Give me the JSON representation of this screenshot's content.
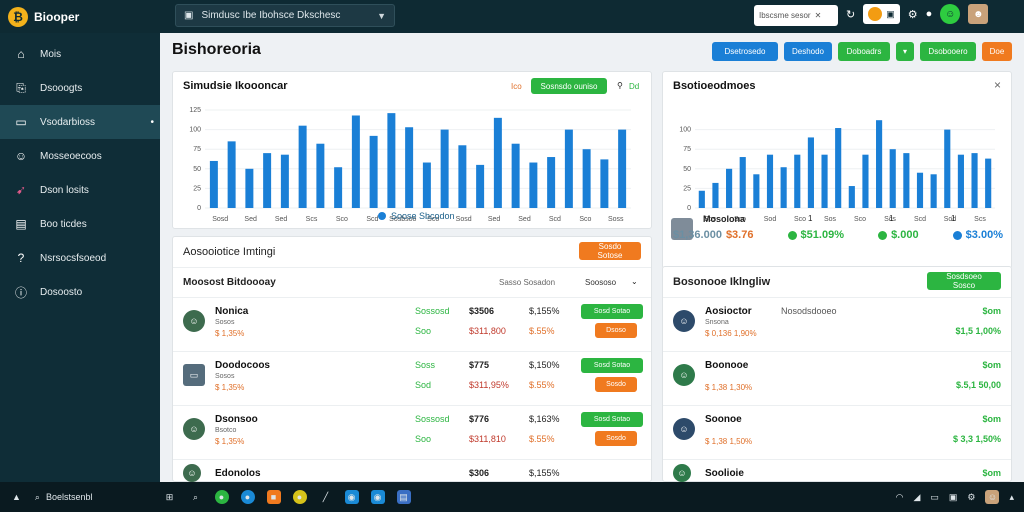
{
  "app": {
    "name": "Biooper"
  },
  "workspace": {
    "label": "Simdusc Ibe Ibohsce Dkschesc"
  },
  "search": {
    "placeholder": "Ibscsme sesor"
  },
  "sidebar": {
    "items": [
      {
        "label": "Mois",
        "icon": "home-icon"
      },
      {
        "label": "Dsooogts",
        "icon": "document-icon"
      },
      {
        "label": "Vsodarbioss",
        "icon": "monitor-icon",
        "active": true
      },
      {
        "label": "Mosseoecoos",
        "icon": "user-icon"
      },
      {
        "label": "Dson losits",
        "icon": "rocket-icon"
      },
      {
        "label": "Boo ticdes",
        "icon": "clipboard-icon"
      },
      {
        "label": "Nsrsocsfsoeod",
        "icon": "help-icon"
      },
      {
        "label": "Dosoosto",
        "icon": "info-icon"
      }
    ]
  },
  "page": {
    "title": "Bishoreoria",
    "actions": [
      "Dsetrosedo",
      "Deshodo",
      "Doboadrs",
      "Dsobooero",
      "Doe"
    ]
  },
  "chart_main": {
    "title": "Simudsie Ikoooncar",
    "toolbar_left": "Ico",
    "toolbar_button": "Sosnsdo ouniso",
    "toolbar_right": "Dd",
    "legend": "Soose Sbcodon"
  },
  "chart_side": {
    "title": "Bsotioeodmoes",
    "close": "×",
    "stat_label": "Mosolona",
    "stats": [
      {
        "value": "$1,36.000",
        "color": "#6b8fa3"
      },
      {
        "value": "$3.76",
        "color": "#e0702a"
      },
      {
        "value": "$51.09%",
        "color": "#2cb541"
      },
      {
        "value": "$.000",
        "color": "#2cb541"
      },
      {
        "value": "$3.00%",
        "color": "#1a7fd6"
      }
    ],
    "markers": [
      "1",
      "1",
      "1"
    ]
  },
  "chart_data": [
    {
      "type": "bar",
      "title": "Simudsie Ikoooncar",
      "categories": [
        "Sosd",
        "Sed",
        "Sed",
        "Scs",
        "Sco",
        "Scd",
        "Sosbsoo",
        "Sco",
        "Sosd",
        "Sed",
        "Sed",
        "Scd",
        "Sco",
        "Soss"
      ],
      "values": [
        60,
        85,
        50,
        70,
        68,
        105,
        82,
        52,
        118,
        92,
        121,
        103,
        58,
        100,
        80,
        55,
        115,
        82,
        58,
        65,
        100,
        75,
        62,
        100
      ],
      "yticks": [
        0,
        25,
        50,
        75,
        100,
        125
      ],
      "ylim": [
        0,
        125
      ],
      "color": "#1a7fd6"
    },
    {
      "type": "bar",
      "title": "Bsotioeodmoes",
      "categories": [
        "Sos",
        "Sco",
        "Sod",
        "Sco",
        "Sos",
        "Sco",
        "Scs",
        "Scd",
        "Sod",
        "Scs"
      ],
      "values": [
        22,
        32,
        50,
        65,
        43,
        68,
        52,
        68,
        90,
        68,
        102,
        28,
        68,
        112,
        75,
        70,
        45,
        43,
        100,
        68,
        70,
        63
      ],
      "yticks": [
        0,
        25,
        50,
        75,
        100
      ],
      "ylim": [
        0,
        125
      ],
      "color": "#1a7fd6"
    }
  ],
  "table_main": {
    "title": "Aosooiotice Imtingi",
    "button": "Sosdo Sotose",
    "header_left": "Moosost Bitdoooay",
    "header_mid": "Sasso Sosadon",
    "header_right": "Soososo",
    "rows": [
      {
        "name": "Nonica",
        "sub": "Sosos",
        "val": "$ 1,35%",
        "badge": "Sossosd",
        "coin": "Soo",
        "price": "$3506",
        "price2": "$311,800",
        "pct": "$,155%",
        "pct2": "$.55%",
        "btn1": "Sosd Sotao",
        "btn2": "Dsoso"
      },
      {
        "name": "Doodocoos",
        "sub": "Sosos",
        "val": "$ 1,35%",
        "badge": "Soss",
        "coin": "Sod",
        "price": "$775",
        "price2": "$311,95%",
        "pct": "$,150%",
        "pct2": "$.55%",
        "btn1": "Sosd Sotao",
        "btn2": "Sosdo"
      },
      {
        "name": "Dsonsoo",
        "sub": "Bsotco",
        "val": "$ 1,35%",
        "badge": "Sossosd",
        "coin": "Soo",
        "price": "$776",
        "price2": "$311,810",
        "pct": "$,163%",
        "pct2": "$.55%",
        "btn1": "Sosd Sotao",
        "btn2": "Sosdo"
      },
      {
        "name": "Edonolos",
        "sub": "",
        "val": "",
        "badge": "",
        "coin": "",
        "price": "$306",
        "price2": "",
        "pct": "$,155%",
        "pct2": "",
        "btn1": "",
        "btn2": ""
      }
    ]
  },
  "table_side": {
    "title": "Bosonooe Iklngliw",
    "button": "Sosdsoeo Sosco",
    "rows": [
      {
        "name": "Aosioctor",
        "tag": "Nosodsdooeo",
        "sub": "Snsona",
        "sub2": "$ 0,136 1,90%",
        "right": "$om",
        "right2": "$1,5 1,00%"
      },
      {
        "name": "Boonooe",
        "tag": "",
        "sub": "",
        "sub2": "$ 1,38 1,30%",
        "right": "$om",
        "right2": "$.5,1 50,00"
      },
      {
        "name": "Soonoe",
        "tag": "",
        "sub": "",
        "sub2": "$ 1,38 1,50%",
        "right": "$om",
        "right2": "$ 3,3 1,50%"
      },
      {
        "name": "Soolioie",
        "tag": "",
        "sub": "",
        "sub2": "",
        "right": "$om",
        "right2": ""
      }
    ]
  },
  "taskbar": {
    "search": "Boelstsenbl"
  }
}
